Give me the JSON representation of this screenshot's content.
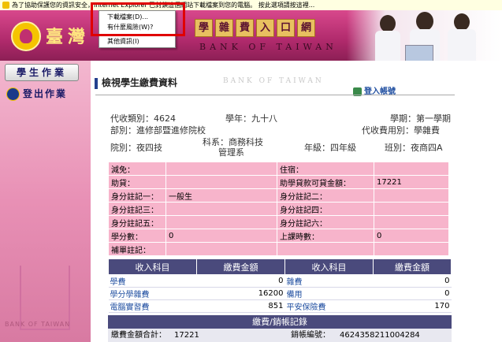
{
  "infobar": {
    "text": "為了協助保護您的資訊安全，Internet Explorer 已封鎖這個網站下載檔案到您的電腦。  按此選項請按這裡..."
  },
  "context_menu": {
    "items": [
      "下載檔案(D)...",
      "有什麼風險(W)?",
      "其他資訊(I)"
    ]
  },
  "banner": {
    "bank_name_zh": "臺灣",
    "portal_title": [
      "學",
      "雜",
      "費",
      "入",
      "口",
      "網"
    ],
    "bank_name_en": "BANK OF TAIWAN"
  },
  "sidebar": {
    "items": [
      {
        "label": "學生作業"
      },
      {
        "label": "登出作業"
      }
    ],
    "watermark": "BANK OF TAIWAN"
  },
  "section": {
    "title": "檢視學生繳費資料",
    "watermark": "BANK OF TAIWAN",
    "login_link": "登入帳號"
  },
  "student_info": {
    "collection_type": "代收類別：4624",
    "school_year": "學年：九十八",
    "semester": "學期：第一學期",
    "division": "部別：進修部暨進修院校",
    "fee_usage": "代收費用別：學雜費",
    "college": "院別：夜四技",
    "department_line1": "科系：商務科技",
    "department_line2": "管理系",
    "grade": "年級：四年級",
    "class": "班別：夜商四A"
  },
  "detail_table": {
    "rows": [
      [
        "減免：",
        "",
        "住宿：",
        ""
      ],
      [
        "助貸：",
        "",
        "助學貸款可貸金額：",
        "17221"
      ],
      [
        "身分註記一：",
        "一般生",
        "身分註記二：",
        ""
      ],
      [
        "身分註記三：",
        "",
        "身分註記四：",
        ""
      ],
      [
        "身分註記五：",
        "",
        "身分註記六：",
        ""
      ],
      [
        "學分數：",
        "0",
        "上課時數：",
        "0"
      ],
      [
        "補單註記：",
        "",
        "",
        ""
      ]
    ]
  },
  "fee_table": {
    "headers": [
      "收入科目",
      "繳費金額",
      "收入科目",
      "繳費金額"
    ],
    "rows": [
      [
        "學費",
        "0",
        "雜費",
        "0"
      ],
      [
        "學分學雜費",
        "16200",
        "備用",
        "0"
      ],
      [
        "電腦實習費",
        "851",
        "平安保險費",
        "170"
      ]
    ]
  },
  "records": {
    "title": "繳費/銷帳記錄",
    "total_label": "繳費金額合計：",
    "total_value": "17221",
    "account_label": "銷帳編號：",
    "account_value": "4624358211004284"
  },
  "colors": {
    "banner": "#c23a7a",
    "sidebar": "#e890b5",
    "table_pink": "#f7b4cb",
    "header_purple": "#4a4a7c",
    "highlight_red": "#e00000"
  }
}
